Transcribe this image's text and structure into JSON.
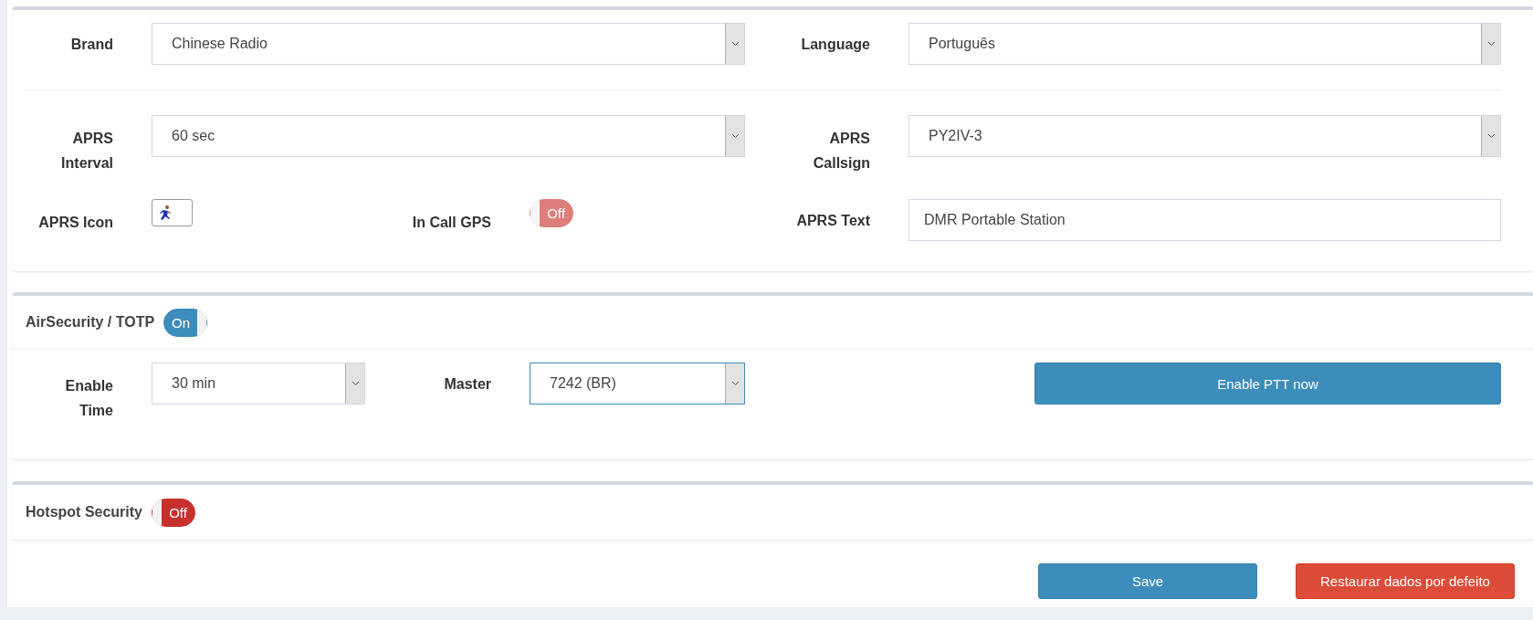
{
  "general": {
    "brand": {
      "label": "Brand",
      "value": "Chinese Radio",
      "focused": false
    },
    "language": {
      "label": "Language",
      "value": "Português",
      "focused": false
    },
    "aprs_interval": {
      "label": "APRS Interval",
      "value": "60 sec",
      "focused": false
    },
    "aprs_callsign": {
      "label": "APRS Callsign",
      "value": "PY2IV-3",
      "focused": false
    },
    "aprs_icon": {
      "label": "APRS Icon"
    },
    "in_call_gps": {
      "label": "In Call GPS",
      "toggle": "Off",
      "on": false,
      "disabled": true
    },
    "aprs_text": {
      "label": "APRS Text",
      "value": "DMR Portable Station"
    }
  },
  "air_security": {
    "title": "AirSecurity / TOTP",
    "toggle": "On",
    "on": true,
    "disabled": false,
    "enable_time": {
      "label": "Enable Time",
      "value": "30 min",
      "focused": false
    },
    "master": {
      "label": "Master",
      "value": "7242 (BR)",
      "focused": true
    },
    "button": "Enable PTT now"
  },
  "hotspot_security": {
    "title": "Hotspot Security",
    "toggle": "Off",
    "on": false,
    "disabled": false
  },
  "buttons": [
    {
      "label": "Save",
      "kind": "primary"
    },
    {
      "label": "Restaurar dados por defeito",
      "kind": "danger"
    }
  ]
}
